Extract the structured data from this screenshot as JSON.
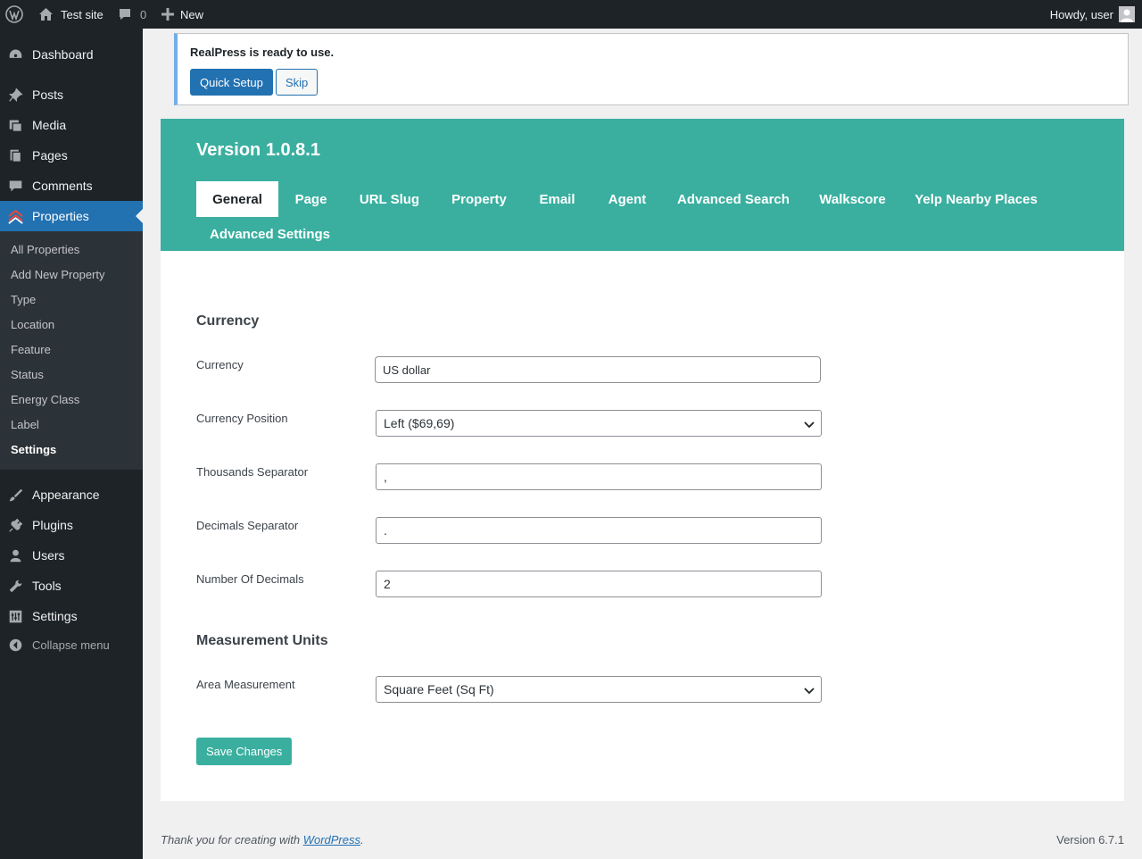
{
  "adminbar": {
    "site_name": "Test site",
    "comments_count": "0",
    "new_label": "New",
    "howdy": "Howdy, user"
  },
  "sidebar": {
    "items": [
      {
        "label": "Dashboard",
        "icon": "dashboard-icon"
      },
      {
        "label": "Posts",
        "icon": "pin-icon"
      },
      {
        "label": "Media",
        "icon": "media-icon"
      },
      {
        "label": "Pages",
        "icon": "pages-icon"
      },
      {
        "label": "Comments",
        "icon": "comment-icon"
      },
      {
        "label": "Properties",
        "icon": "properties-icon"
      },
      {
        "label": "Appearance",
        "icon": "paintbrush-icon"
      },
      {
        "label": "Plugins",
        "icon": "plug-icon"
      },
      {
        "label": "Users",
        "icon": "user-icon"
      },
      {
        "label": "Tools",
        "icon": "wrench-icon"
      },
      {
        "label": "Settings",
        "icon": "sliders-icon"
      }
    ],
    "submenu": [
      "All Properties",
      "Add New Property",
      "Type",
      "Location",
      "Feature",
      "Status",
      "Energy Class",
      "Label",
      "Settings"
    ],
    "collapse_label": "Collapse menu"
  },
  "notice": {
    "message": "RealPress is ready to use.",
    "quick_setup": "Quick Setup",
    "skip": "Skip"
  },
  "settings": {
    "version": "Version 1.0.8.1",
    "tabs": [
      "General",
      "Page",
      "URL Slug",
      "Property",
      "Email",
      "Agent",
      "Advanced Search",
      "Walkscore",
      "Yelp Nearby Places",
      "Advanced Settings"
    ],
    "active_tab": "General",
    "currency_section": "Currency",
    "fields": {
      "currency": {
        "label": "Currency",
        "value": "US dollar"
      },
      "currency_position": {
        "label": "Currency Position",
        "value": "Left ($69,69)"
      },
      "thousands": {
        "label": "Thousands Separator",
        "value": ","
      },
      "decimals_sep": {
        "label": "Decimals Separator",
        "value": "."
      },
      "num_decimals": {
        "label": "Number Of Decimals",
        "value": "2"
      }
    },
    "measurement_section": "Measurement Units",
    "area": {
      "label": "Area Measurement",
      "value": "Square Feet (Sq Ft)"
    },
    "save": "Save Changes"
  },
  "footer": {
    "thanks_prefix": "Thank you for creating with ",
    "wp_link": "WordPress",
    "thanks_suffix": ".",
    "version": "Version 6.7.1"
  },
  "colors": {
    "accent": "#3aaf9f",
    "admin_blue": "#2271b1",
    "sidebar_bg": "#1d2327"
  }
}
